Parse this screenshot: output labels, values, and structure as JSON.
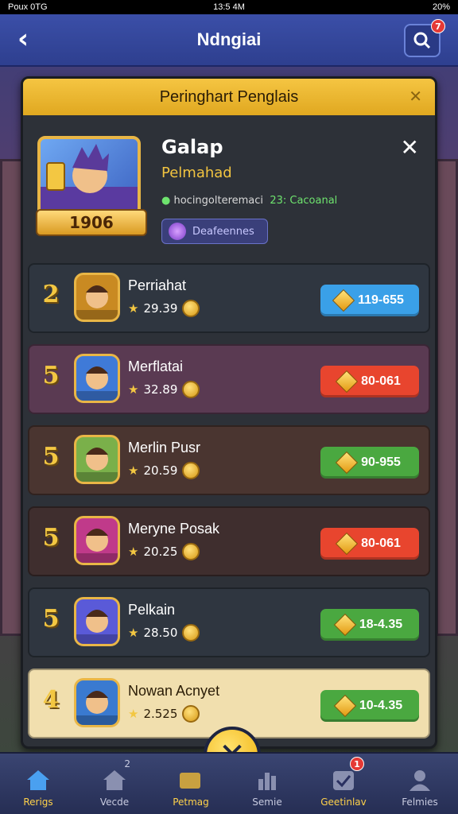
{
  "status_bar": {
    "carrier": "Poux 0TG",
    "time": "13:5 4M",
    "battery": "20%"
  },
  "header": {
    "title": "Ndngiai",
    "search_badge": "7"
  },
  "panel": {
    "title": "Peringhart Penglais"
  },
  "profile": {
    "name": "Galap",
    "subtitle": "Pelmahad",
    "level": "1906",
    "stats_left": "hocingolteremaci",
    "stats_right": "23: Cacoanal",
    "button_label": "Deafeennes"
  },
  "rows": [
    {
      "rank": "2",
      "name": "Perriahat",
      "score": "29.39",
      "pill": "119-655",
      "pill_color": "#3aa0e8",
      "row_bg": "#2f3640",
      "avatar_bg": "#c98a22"
    },
    {
      "rank": "5",
      "name": "Merflatai",
      "score": "32.89",
      "pill": "80-061",
      "pill_color": "#e8452e",
      "row_bg": "#5a3a52",
      "avatar_bg": "#3f7ad8"
    },
    {
      "rank": "5",
      "name": "Merlin Pusr",
      "score": "20.59",
      "pill": "90-955",
      "pill_color": "#4aa840",
      "row_bg": "#4a3530",
      "avatar_bg": "#7ab04a"
    },
    {
      "rank": "5",
      "name": "Meryne Posak",
      "score": "20.25",
      "pill": "80-061",
      "pill_color": "#e8452e",
      "row_bg": "#3f2e2e",
      "avatar_bg": "#c03a8a"
    },
    {
      "rank": "5",
      "name": "Pelkain",
      "score": "28.50",
      "pill": "18-4.35",
      "pill_color": "#4aa840",
      "row_bg": "#2f3640",
      "avatar_bg": "#5a5ad8"
    },
    {
      "rank": "4",
      "name": "Nowan Acnyet",
      "score": "2.525",
      "pill": "10-4.35",
      "pill_color": "#4aa840",
      "row_bg": "#f1dfae",
      "avatar_bg": "#3a7ad0"
    }
  ],
  "nav": {
    "items": [
      "Rerigs",
      "Vecde",
      "Petmag",
      "Semie",
      "Geetinlav",
      "Felmies"
    ],
    "badge_vecde": "2",
    "badge_geetinlav": "1"
  }
}
